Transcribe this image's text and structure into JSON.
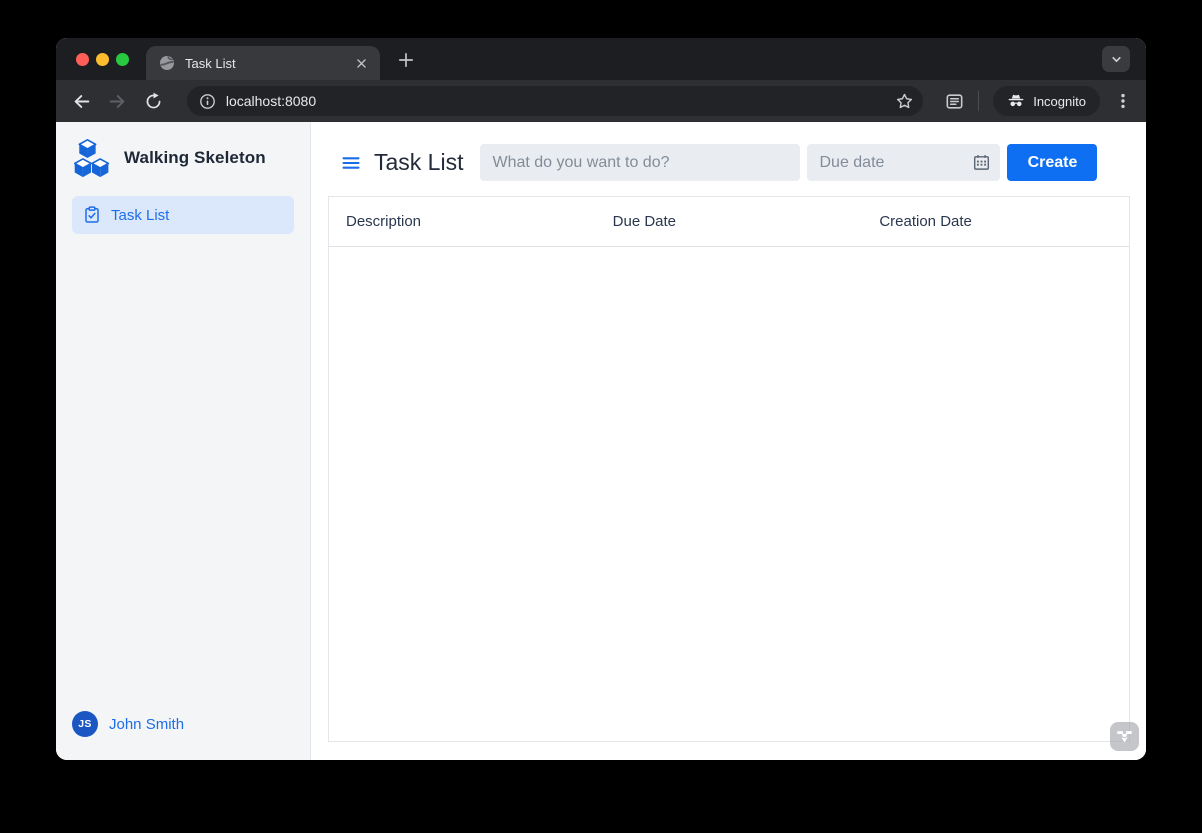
{
  "browser": {
    "tab_title": "Task List",
    "url": "localhost:8080",
    "incognito_label": "Incognito"
  },
  "sidebar": {
    "app_name": "Walking Skeleton",
    "nav_task_list": "Task List",
    "user_initials": "JS",
    "user_name": "John Smith"
  },
  "main": {
    "view_title": "Task List",
    "task_placeholder": "What do you want to do?",
    "due_date_placeholder": "Due date",
    "create_label": "Create",
    "table_columns": [
      "Description",
      "Due Date",
      "Creation Date"
    ],
    "rows": []
  },
  "icons": {
    "tab_favicon": "globe",
    "app_logo": "cubes",
    "nav_task_list": "clipboard-check",
    "view_menu": "hamburger",
    "due_date": "calendar",
    "address_left": "info-circle",
    "address_right": "bookmark-star",
    "browser_mode": "incognito-hat-glasses",
    "dev_badge": "vaadin-logo"
  },
  "colors": {
    "primary_blue": "#1d6ee9",
    "create_button_blue": "#0e6ff2",
    "avatar_blue": "#1a57c2",
    "nav_active_bg": "#dbe7fb",
    "sidebar_bg": "#f4f5f7",
    "chrome_tabstrip": "#1d1e21",
    "chrome_toolbar": "#2e2f33",
    "chrome_omnibox": "#222327"
  }
}
